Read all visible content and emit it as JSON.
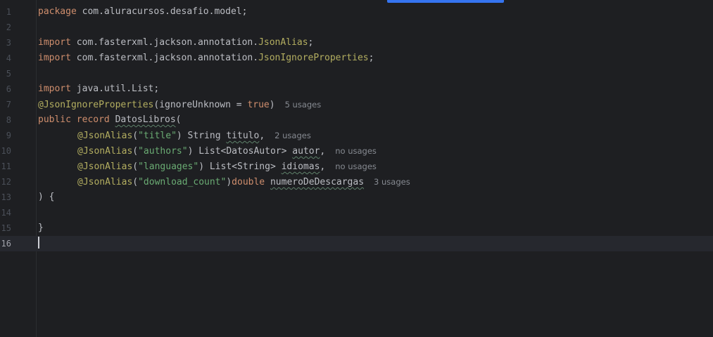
{
  "editor": {
    "lines": [
      {
        "num": "1",
        "t": {
          "kw": "package",
          "rest": " com.aluracursos.desafio.model;"
        }
      },
      {
        "num": "2"
      },
      {
        "num": "3",
        "t": {
          "kw": "import",
          "pkg": " com.fasterxml.jackson.annotation.",
          "cls": "JsonAlias",
          "end": ";"
        }
      },
      {
        "num": "4",
        "t": {
          "kw": "import",
          "pkg": " com.fasterxml.jackson.annotation.",
          "cls": "JsonIgnoreProperties",
          "end": ";"
        }
      },
      {
        "num": "5"
      },
      {
        "num": "6",
        "t": {
          "kw": "import",
          "rest": " java.util.List;"
        }
      },
      {
        "num": "7",
        "t": {
          "ann": "@JsonIgnoreProperties",
          "open": "(ignoreUnknown = ",
          "val": "true",
          "close": ")",
          "hint": "5 usages"
        }
      },
      {
        "num": "8",
        "t": {
          "kw": "public record",
          "sp": " ",
          "name": "DatosLibros",
          "open": "("
        }
      },
      {
        "num": "9",
        "t": {
          "ann": "@JsonAlias",
          "open": "(",
          "str": "\"title\"",
          "close": ") String ",
          "field": "titulo",
          "end": ",",
          "hint": "2 usages"
        }
      },
      {
        "num": "10",
        "t": {
          "ann": "@JsonAlias",
          "open": "(",
          "str": "\"authors\"",
          "close": ") List<DatosAutor> ",
          "field": "autor",
          "end": ",",
          "hint": "no usages"
        }
      },
      {
        "num": "11",
        "t": {
          "ann": "@JsonAlias",
          "open": "(",
          "str": "\"languages\"",
          "close": ") List<String> ",
          "field": "idiomas",
          "end": ",",
          "hint": "no usages"
        }
      },
      {
        "num": "12",
        "t": {
          "ann": "@JsonAlias",
          "open": "(",
          "str": "\"download_count\"",
          "close": ")",
          "kw": "double",
          "sp": " ",
          "field_a": "numeroDe",
          "field_b": "Descargas",
          "hint": "3 usages"
        }
      },
      {
        "num": "13",
        "t": {
          "rest": ") {"
        }
      },
      {
        "num": "14"
      },
      {
        "num": "15",
        "t": {
          "rest": "}"
        }
      },
      {
        "num": "16"
      }
    ]
  }
}
